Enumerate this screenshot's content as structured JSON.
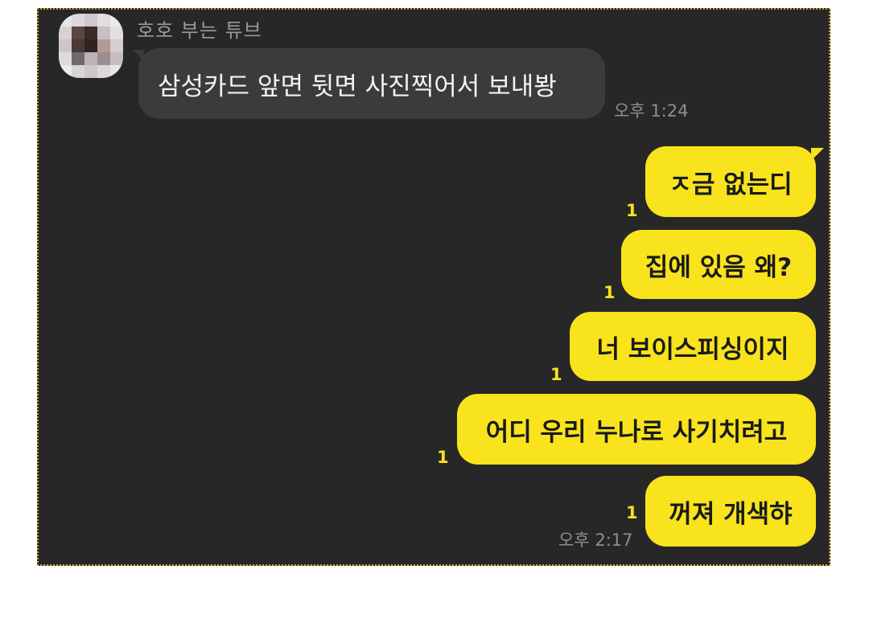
{
  "chat": {
    "sender_name": "호호 부는 튜브",
    "incoming": {
      "text": "삼성카드 앞면 뒷면 사진찍어서 보내봥",
      "time": "오후 1:24"
    },
    "outgoing": [
      {
        "text": "ㅈ금 없는디",
        "unread": "1"
      },
      {
        "text": "집에 있음 왜?",
        "unread": "1"
      },
      {
        "text": "너 보이스피싱이지",
        "unread": "1"
      },
      {
        "text": "어디 우리 누나로 사기치려고",
        "unread": "1"
      },
      {
        "text": "꺼져 개색햐",
        "unread": "1",
        "time": "오후 2:17"
      }
    ]
  },
  "colors": {
    "background": "#272727",
    "incoming_bubble": "#3b3b3b",
    "outgoing_bubble": "#f8e31c",
    "unread_count": "#f8e31c",
    "frame_border": "#c9a227"
  },
  "icons": {
    "avatar": "pixelated-profile-avatar"
  }
}
